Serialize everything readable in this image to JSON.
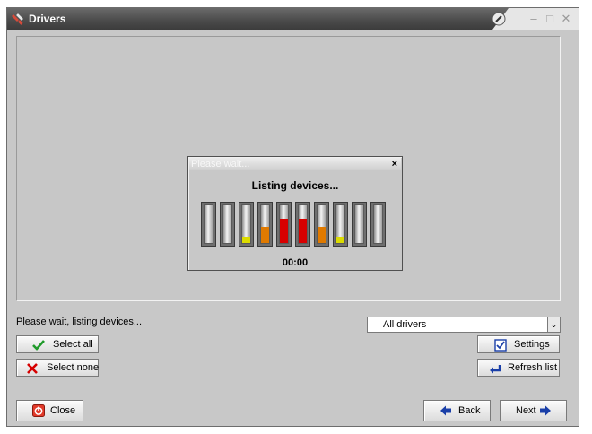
{
  "window": {
    "title": "Drivers",
    "colors": {
      "title_bar": "#4a4a4a",
      "body": "#c8c8c8"
    },
    "icons": {
      "app": "drivers-app-icon",
      "pin": "pin-icon",
      "minimize": "minimize-icon",
      "maximize": "maximize-icon",
      "close": "close-icon"
    },
    "minimize_glyph": "–",
    "maximize_glyph": "□",
    "close_glyph": "✕"
  },
  "wait_dialog": {
    "title": "Please wait...",
    "close_glyph": "×",
    "message": "Listing devices...",
    "timer": "00:00",
    "bars": [
      {
        "level": 0,
        "color": ""
      },
      {
        "level": 0,
        "color": ""
      },
      {
        "level": 0.15,
        "color": "#dcdc00"
      },
      {
        "level": 0.42,
        "color": "#e07a00"
      },
      {
        "level": 0.62,
        "color": "#d80000"
      },
      {
        "level": 0.62,
        "color": "#d80000"
      },
      {
        "level": 0.42,
        "color": "#e07a00"
      },
      {
        "level": 0.15,
        "color": "#dcdc00"
      },
      {
        "level": 0,
        "color": ""
      },
      {
        "level": 0,
        "color": ""
      }
    ]
  },
  "status": {
    "text": "Please wait, listing devices..."
  },
  "filter": {
    "selected": "All drivers",
    "arrow_glyph": "⌄"
  },
  "buttons": {
    "select_all": "Select all",
    "select_none": "Select none",
    "settings": "Settings",
    "refresh_list": "Refresh list",
    "close": "Close",
    "back": "Back",
    "next": "Next"
  },
  "icon_names": {
    "select_all": "check-icon",
    "select_none": "x-icon",
    "settings": "checkbox-icon",
    "refresh_list": "refresh-arrow-icon",
    "close": "power-icon",
    "back": "arrow-left-icon",
    "next": "arrow-right-icon"
  }
}
